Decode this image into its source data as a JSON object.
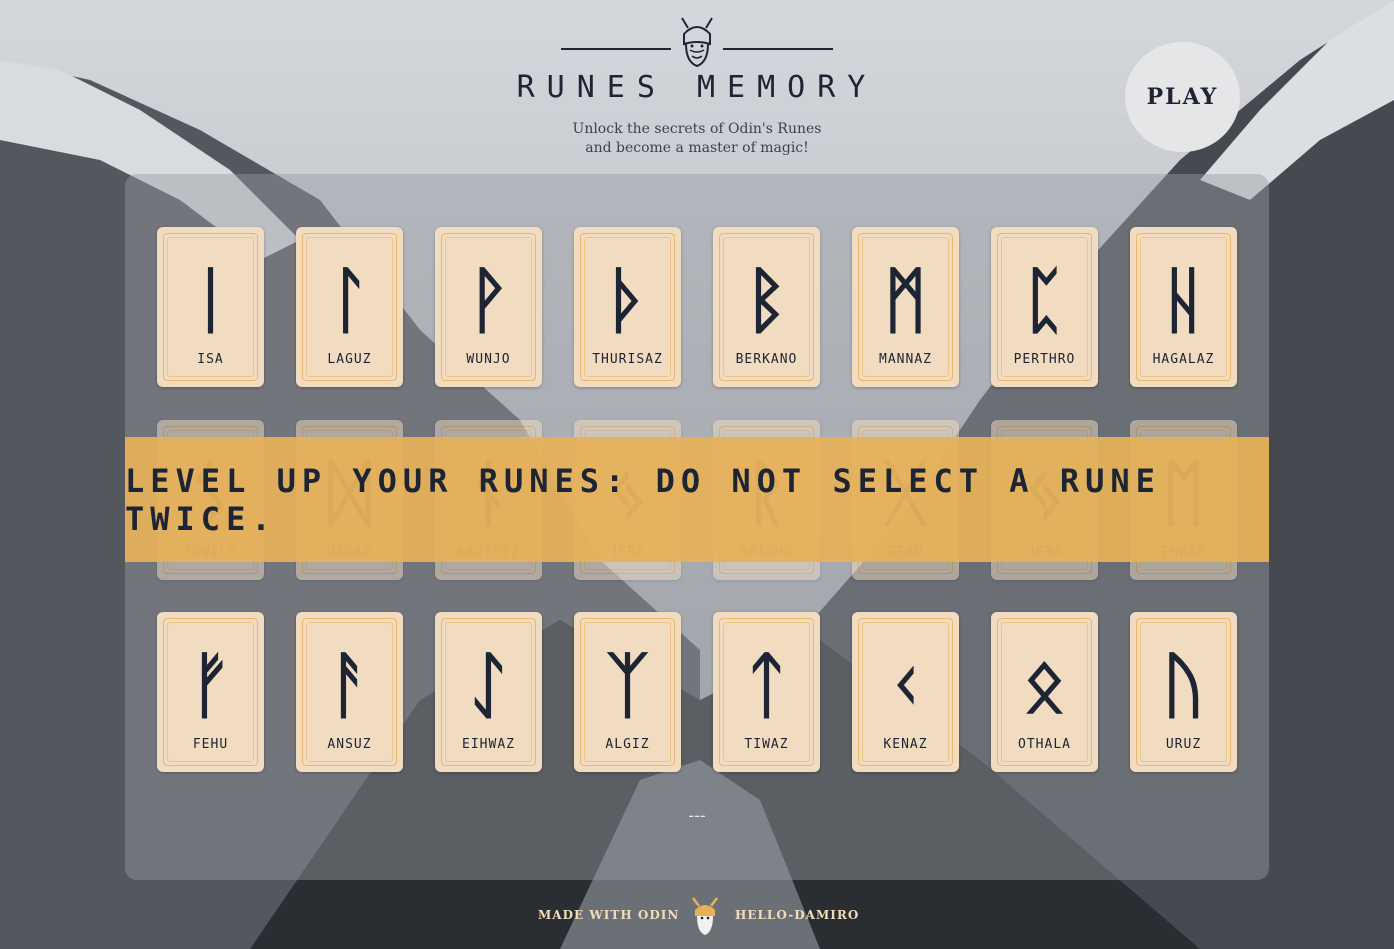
{
  "header": {
    "title": "RUNES MEMORY",
    "subtitle_line1": "Unlock the secrets of Odin's Runes",
    "subtitle_line2": "and become a master of magic!",
    "logo_icon": "viking-helmet-icon"
  },
  "play_button": {
    "label": "PLAY"
  },
  "cards": {
    "row1": [
      {
        "rune": "ᛁ",
        "name": "ISA"
      },
      {
        "rune": "ᛚ",
        "name": "LAGUZ"
      },
      {
        "rune": "ᚹ",
        "name": "WUNJO"
      },
      {
        "rune": "ᚦ",
        "name": "THURISAZ"
      },
      {
        "rune": "ᛒ",
        "name": "BERKANO"
      },
      {
        "rune": "ᛗ",
        "name": "MANNAZ"
      },
      {
        "rune": "ᛈ",
        "name": "PERTHRO"
      },
      {
        "rune": "ᚺ",
        "name": "HAGALAZ"
      }
    ],
    "row2_hidden": [
      {
        "rune": "ᛊ",
        "name": "SOWILO"
      },
      {
        "rune": "ᛞ",
        "name": "DAGAZ"
      },
      {
        "rune": "ᚾ",
        "name": "NAUTHIZ"
      },
      {
        "rune": "ᛃ",
        "name": "JERA"
      },
      {
        "rune": "ᚱ",
        "name": "RAIDHO"
      },
      {
        "rune": "ᚷ",
        "name": "GEBO"
      },
      {
        "rune": "ᛃ",
        "name": "JERA"
      },
      {
        "rune": "ᛖ",
        "name": "EHWAZ"
      }
    ],
    "row3": [
      {
        "rune": "ᚠ",
        "name": "FEHU"
      },
      {
        "rune": "ᚨ",
        "name": "ANSUZ"
      },
      {
        "rune": "ᛇ",
        "name": "EIHWAZ"
      },
      {
        "rune": "ᛉ",
        "name": "ALGIZ"
      },
      {
        "rune": "ᛏ",
        "name": "TIWAZ"
      },
      {
        "rune": "ᚲ",
        "name": "KENAZ"
      },
      {
        "rune": "ᛟ",
        "name": "OTHALA"
      },
      {
        "rune": "ᚢ",
        "name": "URUZ"
      }
    ]
  },
  "banner": {
    "text": "LEVEL UP YOUR RUNES: DO NOT SELECT A RUNE TWICE."
  },
  "score": {
    "text": "---"
  },
  "footer": {
    "made_with": "MADE WITH ODIN",
    "author": "HELLO-DAMIRO",
    "icon": "odin-head-icon"
  },
  "colors": {
    "card_bg": "#f1dcc2",
    "card_border": "#e7b970",
    "banner": "#e6b258",
    "ink": "#1d2433"
  }
}
